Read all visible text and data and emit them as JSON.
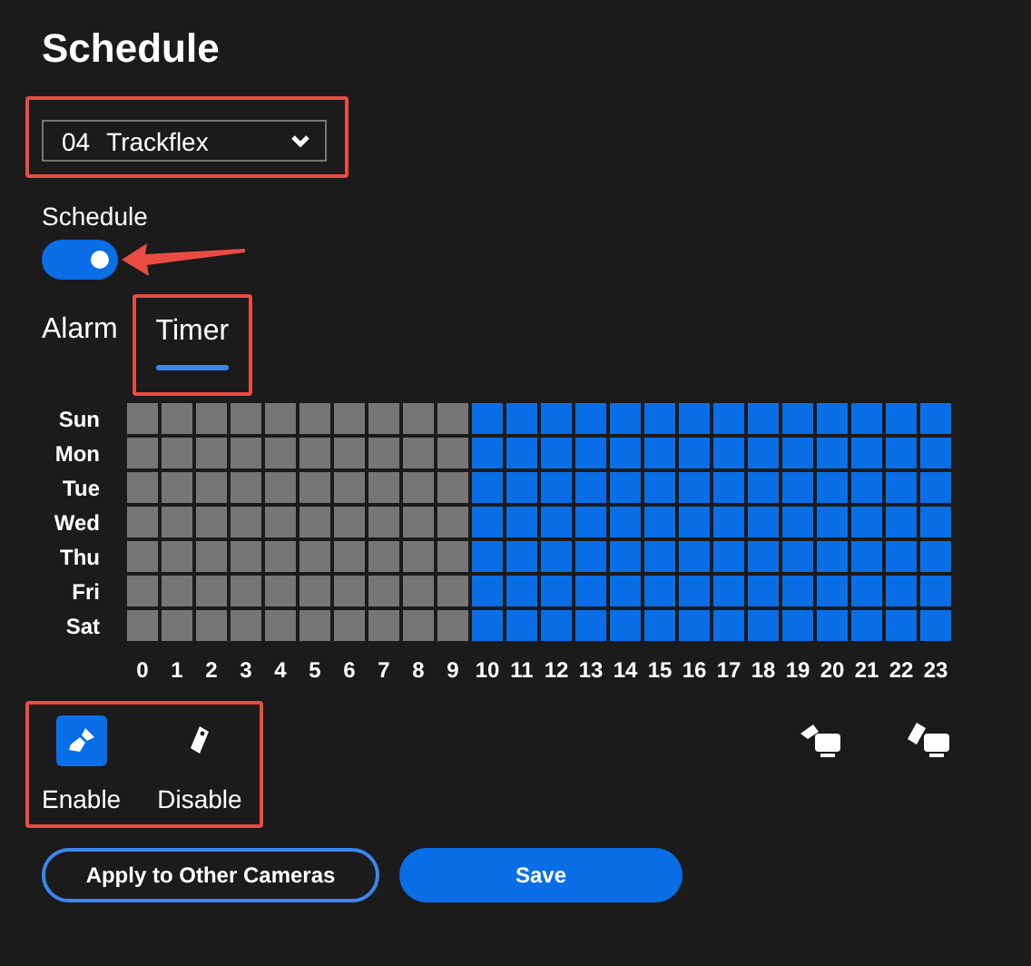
{
  "title": "Schedule",
  "camera_select": {
    "number": "04",
    "name": "Trackflex"
  },
  "schedule_toggle": {
    "label": "Schedule",
    "on": true
  },
  "tabs": [
    {
      "label": "Alarm",
      "selected": false
    },
    {
      "label": "Timer",
      "selected": true
    }
  ],
  "grid": {
    "days": [
      {
        "label": "Sun",
        "slots": [
          false,
          false,
          false,
          false,
          false,
          false,
          false,
          false,
          false,
          false,
          true,
          true,
          true,
          true,
          true,
          true,
          true,
          true,
          true,
          true,
          true,
          true,
          true,
          true
        ]
      },
      {
        "label": "Mon",
        "slots": [
          false,
          false,
          false,
          false,
          false,
          false,
          false,
          false,
          false,
          false,
          true,
          true,
          true,
          true,
          true,
          true,
          true,
          true,
          true,
          true,
          true,
          true,
          true,
          true
        ]
      },
      {
        "label": "Tue",
        "slots": [
          false,
          false,
          false,
          false,
          false,
          false,
          false,
          false,
          false,
          false,
          true,
          true,
          true,
          true,
          true,
          true,
          true,
          true,
          true,
          true,
          true,
          true,
          true,
          true
        ]
      },
      {
        "label": "Wed",
        "slots": [
          false,
          false,
          false,
          false,
          false,
          false,
          false,
          false,
          false,
          false,
          true,
          true,
          true,
          true,
          true,
          true,
          true,
          true,
          true,
          true,
          true,
          true,
          true,
          true
        ]
      },
      {
        "label": "Thu",
        "slots": [
          false,
          false,
          false,
          false,
          false,
          false,
          false,
          false,
          false,
          false,
          true,
          true,
          true,
          true,
          true,
          true,
          true,
          true,
          true,
          true,
          true,
          true,
          true,
          true
        ]
      },
      {
        "label": "Fri",
        "slots": [
          false,
          false,
          false,
          false,
          false,
          false,
          false,
          false,
          false,
          false,
          true,
          true,
          true,
          true,
          true,
          true,
          true,
          true,
          true,
          true,
          true,
          true,
          true,
          true
        ]
      },
      {
        "label": "Sat",
        "slots": [
          false,
          false,
          false,
          false,
          false,
          false,
          false,
          false,
          false,
          false,
          true,
          true,
          true,
          true,
          true,
          true,
          true,
          true,
          true,
          true,
          true,
          true,
          true,
          true
        ]
      }
    ],
    "hours": [
      "0",
      "1",
      "2",
      "3",
      "4",
      "5",
      "6",
      "7",
      "8",
      "9",
      "10",
      "11",
      "12",
      "13",
      "14",
      "15",
      "16",
      "17",
      "18",
      "19",
      "20",
      "21",
      "22",
      "23"
    ]
  },
  "tools": [
    {
      "label": "Enable",
      "kind": "brush",
      "selected": true
    },
    {
      "label": "Disable",
      "kind": "eraser",
      "selected": false
    }
  ],
  "buttons": [
    {
      "label": "Apply to Other Cameras",
      "kind": "outline"
    },
    {
      "label": "Save",
      "kind": "primary"
    }
  ]
}
